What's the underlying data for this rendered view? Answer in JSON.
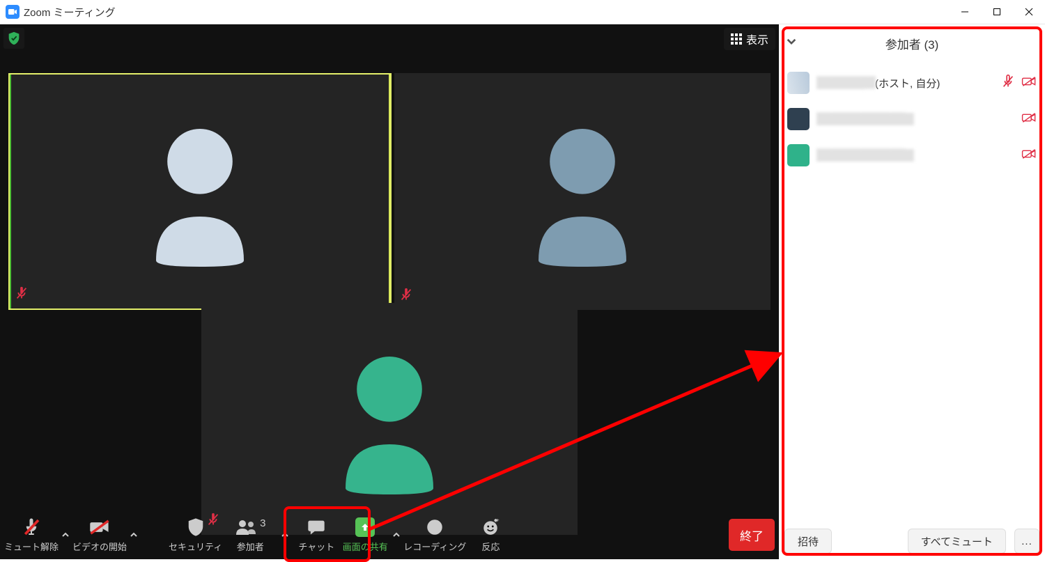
{
  "window": {
    "title": "Zoom ミーティング"
  },
  "top": {
    "view_label": "表示"
  },
  "tiles": {
    "count": 3
  },
  "toolbar": {
    "unmute": "ミュート解除",
    "start_video": "ビデオの開始",
    "security": "セキュリティ",
    "participants": "参加者",
    "participants_count": "3",
    "chat": "チャット",
    "share": "画面の共有",
    "record": "レコーディング",
    "reactions": "反応",
    "end": "終了"
  },
  "panel": {
    "title": "参加者 (3)",
    "rows": [
      {
        "name": "████████",
        "suffix": "(ホスト, 自分)",
        "mic_muted": true,
        "video_off": true
      },
      {
        "name": "████████████",
        "suffix": "",
        "mic_muted": false,
        "video_off": true
      },
      {
        "name": "████████████",
        "suffix": "",
        "mic_muted": false,
        "video_off": true
      }
    ],
    "invite": "招待",
    "mute_all": "すべてミュート",
    "more": "..."
  }
}
